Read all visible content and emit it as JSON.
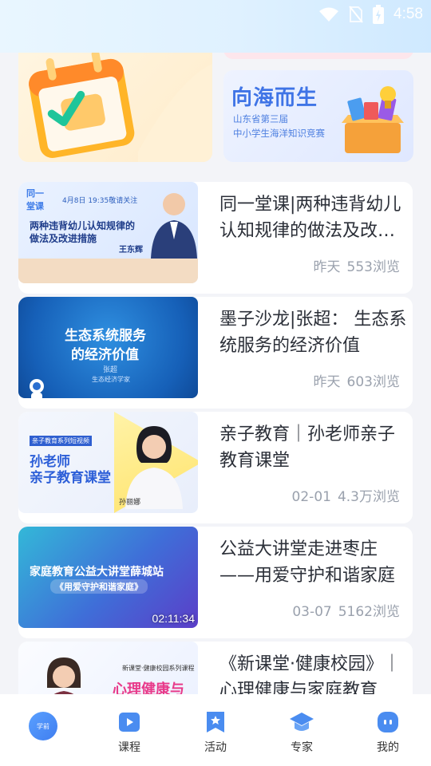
{
  "status": {
    "time": "4:58"
  },
  "banners": {
    "right": {
      "title": "向海而生",
      "subtitle_line1": "山东省第三届",
      "subtitle_line2": "中小学生海洋知识竞赛"
    }
  },
  "feed": [
    {
      "title": "同一堂课|两种违背幼儿认知规律的做法及改进措施",
      "date": "昨天",
      "views": "553浏览",
      "thumb": {
        "tag": "4月8日 19:35敬请关注",
        "headline_line1": "两种违背幼儿认知规律的",
        "headline_line2": "做法及改进措施",
        "person": "王东辉"
      }
    },
    {
      "title": "墨子沙龙|张超： 生态系统服务的经济价值",
      "date": "昨天",
      "views": "603浏览",
      "thumb": {
        "headline_line1": "生态系统服务",
        "headline_line2": "的经济价值",
        "person": "张超",
        "role": "生态经济学家"
      }
    },
    {
      "title": "亲子教育｜孙老师亲子教育课堂",
      "date": "02-01",
      "views": "4.3万浏览",
      "thumb": {
        "tag": "亲子教育系列短视频",
        "headline_line1": "孙老师",
        "headline_line2": "亲子教育课堂",
        "person": "孙丽娜"
      }
    },
    {
      "title": "公益大讲堂走进枣庄——用爱守护和谐家庭",
      "date": "03-07",
      "views": "5162浏览",
      "thumb": {
        "headline_line1": "家庭教育公益大讲堂薛城站",
        "headline_line2": "《用爱守护和谐家庭》",
        "duration": "02:11:34"
      }
    },
    {
      "title": "《新课堂·健康校园》｜心理健康与家庭教育",
      "date": "",
      "views": "",
      "thumb": {
        "tag": "新课堂·健康校园系列课程",
        "headline_line1": "心理健康与"
      }
    }
  ],
  "nav": {
    "home_badge": "学前",
    "items": [
      "课程",
      "活动",
      "专家",
      "我的"
    ]
  },
  "colors": {
    "accent": "#3f7ef0",
    "muted": "#9aa1ad"
  }
}
